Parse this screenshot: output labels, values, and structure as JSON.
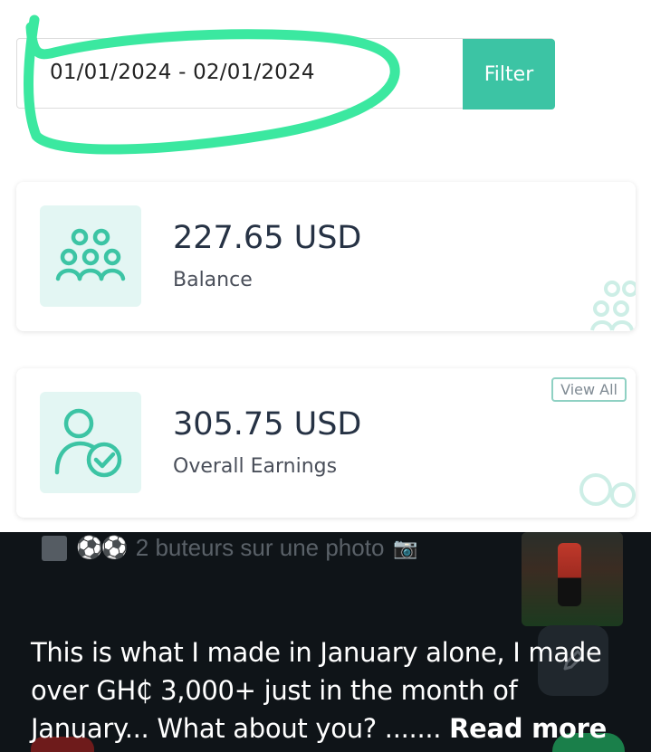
{
  "filter": {
    "date_range": "01/01/2024 - 02/01/2024",
    "button_label": "Filter"
  },
  "cards": {
    "balance": {
      "amount": "227.65 USD",
      "label": "Balance",
      "icon": "users-group-icon"
    },
    "earnings": {
      "amount": "305.75 USD",
      "label": "Overall Earnings",
      "icon": "user-check-icon",
      "view_all": "View All"
    }
  },
  "overlay": {
    "notification_text": "2 buteurs sur une photo",
    "caption": "This is what I made in January alone, I made over GH₵ 3,000+ just in the month of January... What about you? .......",
    "read_more": "Read more"
  },
  "colors": {
    "accent": "#3cc4a4",
    "highlight_marker": "#3be8a0",
    "tile_bg": "#e3f6f3",
    "dark_bg": "#0f1418"
  }
}
